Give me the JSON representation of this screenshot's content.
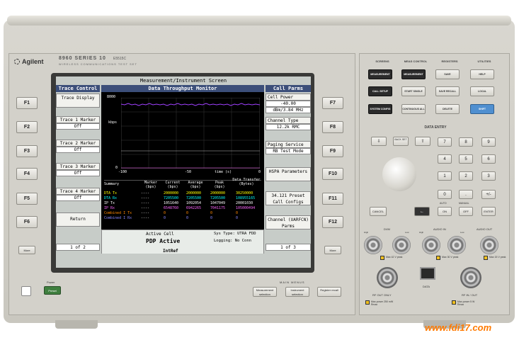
{
  "brand": "Agilent",
  "model": "8960 SERIES 10",
  "model_sub": "WIRELESS COMMUNICATIONS TEST SET",
  "model_num": "E5515C",
  "screen": {
    "title": "Measurement/Instrument Screen",
    "left_header": "Trace Control",
    "center_header": "Data Throughput Monitor",
    "right_header": "Call Parms",
    "left_keys": [
      {
        "label": "Trace Display",
        "value": ""
      },
      {
        "label": "Trace 1 Marker",
        "value": "Off"
      },
      {
        "label": "Trace 2 Marker",
        "value": "Off"
      },
      {
        "label": "Trace 3 Marker",
        "value": "Off"
      },
      {
        "label": "Trace 4 Marker",
        "value": "Off"
      },
      {
        "label": "Return",
        "value": ""
      }
    ],
    "right_keys": [
      {
        "label": "Cell Power",
        "value": "-40.00",
        "value2": "dBm/3.84 MHz"
      },
      {
        "label": "Channel Type",
        "value": "12.2k RMC"
      },
      {
        "label": "Paging Service",
        "value": "RB Test Mode"
      },
      {
        "label": "HSPA Parameters",
        "value": ""
      },
      {
        "label": "34.121 Preset Call Configs",
        "value": ""
      },
      {
        "label": "Channel (UARFCN) Parms",
        "value": ""
      }
    ],
    "graph": {
      "y_top": "8000",
      "y_mid": "kbps",
      "y_bot": "0",
      "x_left": "-100",
      "x_mid": "-50",
      "x_unit": "time (s)",
      "x_right": "0"
    },
    "summary": {
      "headers": [
        "Summary",
        "Marker (bps)",
        "Current (bps)",
        "Average (bps)",
        "Peak (bps)",
        "Data Transfer (Bytes)"
      ],
      "rows": [
        {
          "name": "DTA Tx",
          "marker": "----",
          "current": "2000000",
          "average": "2000000",
          "peak": "2000000",
          "transfer": "30250000",
          "color": "#ffff00"
        },
        {
          "name": "DTA Rx",
          "marker": "----",
          "current": "7205500",
          "average": "7205500",
          "peak": "7205500",
          "transfer": "108955165",
          "color": "#00ffff"
        },
        {
          "name": "IP Tx",
          "marker": "----",
          "current": "1051640",
          "average": "1092054",
          "peak": "1047049",
          "transfer": "20001030",
          "color": "#ffffff"
        },
        {
          "name": "IP Rx",
          "marker": "----",
          "current": "6548760",
          "average": "6942265",
          "peak": "7041175",
          "transfer": "105000494",
          "color": "#ff66ff"
        },
        {
          "name": "Combined I Tx",
          "marker": "----",
          "current": "0",
          "average": "0",
          "peak": "0",
          "transfer": "0",
          "color": "#ff8800"
        },
        {
          "name": "Combined I Rx",
          "marker": "----",
          "current": "0",
          "average": "0",
          "peak": "0",
          "transfer": "0",
          "color": "#8888ff"
        }
      ]
    },
    "status": {
      "active_cell_label": "Active Cell",
      "active_cell_value": "PDP Active",
      "sys_type": "Sys Type: UTRA FDD",
      "logging": "Logging: No Conn",
      "page_left": "1 of 2",
      "page_right": "1 of 3",
      "intref": "IntRef"
    }
  },
  "fkeys_left": [
    "F1",
    "F2",
    "F3",
    "F4",
    "F5",
    "F6"
  ],
  "fkeys_right": [
    "F7",
    "F8",
    "F9",
    "F10",
    "F11",
    "F12"
  ],
  "more_label": "More",
  "power_label": "Power",
  "preset_label": "Preset",
  "main_menus_label": "MAIN MENUS",
  "main_menu_buttons": [
    "Measurement selection",
    "Instrument selection",
    "Register recall"
  ],
  "right_panel": {
    "groups": [
      "SCREENS",
      "MEAS CONTROL",
      "REGISTERS",
      "UTILITIES"
    ],
    "buttons": [
      {
        "label": "MEASUREMENT",
        "style": "dark"
      },
      {
        "label": "MEASUREMENT RESET",
        "style": "dark"
      },
      {
        "label": "SAVE",
        "style": "light"
      },
      {
        "label": "HELP",
        "style": "light"
      },
      {
        "label": "CALL SETUP",
        "style": "dark"
      },
      {
        "label": "START SINGLE",
        "style": "light"
      },
      {
        "label": "SAVE RECALL",
        "style": "light"
      },
      {
        "label": "LOCAL",
        "style": "light"
      },
      {
        "label": "SYSTEM CONFIG",
        "style": "dark"
      },
      {
        "label": "CONTINUOUS ALL",
        "style": "light"
      },
      {
        "label": "DELETE",
        "style": "light"
      },
      {
        "label": "SHIFT",
        "style": "blue"
      }
    ],
    "data_entry_label": "DATA ENTRY",
    "nav_buttons": [
      "⇩",
      "BACK SET",
      "⇧"
    ],
    "keypad": [
      "7",
      "8",
      "9",
      "4",
      "5",
      "6",
      "1",
      "2",
      "3",
      "0",
      ".",
      "+/-"
    ],
    "cancel_label": "CANCEL",
    "backspace_label": "←",
    "on_label": "ON",
    "off_label": "OFF",
    "enter_label": "ENTER",
    "auto_label": "AUTO",
    "manual_label": "MANUAL",
    "connectors": {
      "dvm": "DVM",
      "audio_in": "AUDIO IN",
      "audio_out": "AUDIO OUT",
      "high": "High",
      "low": "Low",
      "dvm_max": "Max 42 V peak",
      "audio_in_max": "Max 30 V peak",
      "audio_out_max": "Max 15 V peak",
      "rf_out_only": "RF OUT ONLY",
      "data": "DATA",
      "rf_in_out": "RF IN / OUT",
      "rf_out_max": "Max power 250 mW Rmax",
      "rf_in_max": "Max power 5 W Rmax"
    }
  },
  "watermark": "www.fdi17.com",
  "colors": {
    "screen_header": "#3c4f7a",
    "trace": "#a040ff",
    "shift": "#4f8fd0"
  }
}
